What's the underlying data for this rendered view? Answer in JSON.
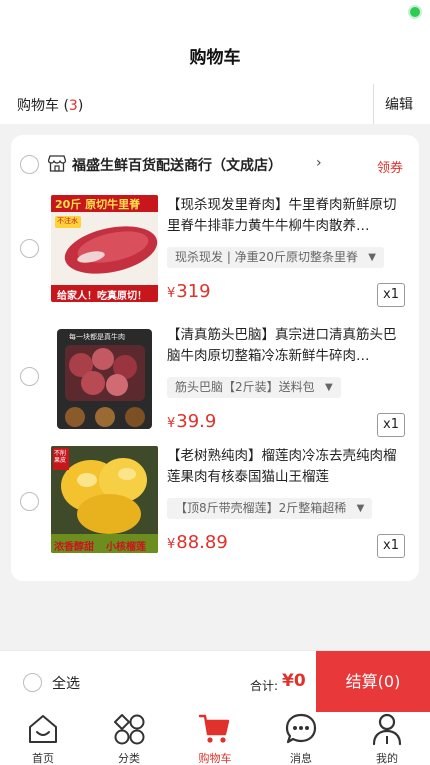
{
  "header": {
    "title": "购物车"
  },
  "subbar": {
    "label": "购物车",
    "count_open": " (",
    "count": "3",
    "count_close": ")",
    "edit": "编辑"
  },
  "store": {
    "name": "福盛生鲜百货配送商行（文成店）",
    "chevron": "›",
    "coupon": "领券"
  },
  "items": [
    {
      "title": "【现杀现发里脊肉】牛里脊肉新鲜原切里脊牛排菲力黄牛牛柳牛肉散养…",
      "spec": "现杀现发 | 净重20斤原切整条里脊",
      "price": "319",
      "qty": "x1",
      "thumb": {
        "banner": "20斤 原切牛里脊",
        "tag": "不注水",
        "footer": "给家人！吃真原切！"
      }
    },
    {
      "title": "【清真筋头巴脑】真宗进口清真筋头巴脑牛肉原切整箱冷冻新鲜牛碎肉…",
      "spec": "筋头巴脑【2斤装】送料包",
      "price": "39.9",
      "qty": "x1",
      "thumb": {
        "banner": "每一块都是真牛肉"
      }
    },
    {
      "title": "【老树熟纯肉】榴莲肉冷冻去壳纯肉榴莲果肉有核泰国猫山王榴莲",
      "spec": "【顶8斤带壳榴莲】2斤整箱超稀",
      "price": "88.89",
      "qty": "x1",
      "thumb": {
        "tag": "不削果皮",
        "footer_left": "浓香醇甜",
        "footer_right": "小核榴莲"
      }
    }
  ],
  "currency": "¥",
  "footer": {
    "select_all": "全选",
    "total_label": "合计:",
    "total_value": "¥0",
    "checkout": "结算(0)"
  },
  "tabs": [
    {
      "label": "首页",
      "icon": "home-icon"
    },
    {
      "label": "分类",
      "icon": "category-icon"
    },
    {
      "label": "购物车",
      "icon": "cart-icon",
      "active": true
    },
    {
      "label": "消息",
      "icon": "message-icon"
    },
    {
      "label": "我的",
      "icon": "profile-icon"
    }
  ],
  "colors": {
    "accent": "#e0322b",
    "checkout_bg": "#e8383a",
    "background": "#f2f2f2"
  }
}
